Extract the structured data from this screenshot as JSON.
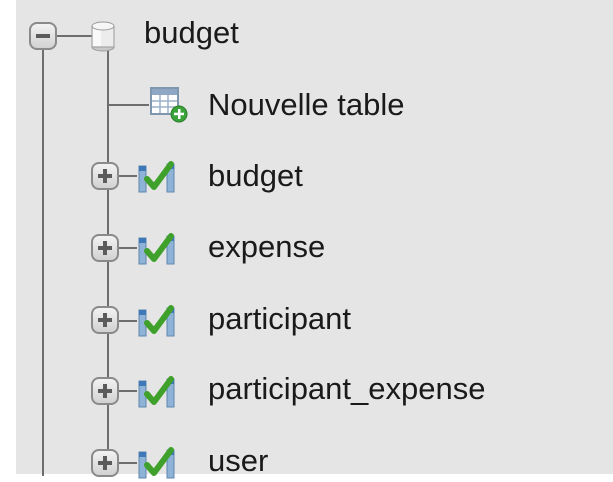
{
  "tree": {
    "database": {
      "label": "budget",
      "expanded": true
    },
    "new_table": {
      "label": "Nouvelle table"
    },
    "tables": [
      {
        "label": "budget"
      },
      {
        "label": "expense"
      },
      {
        "label": "participant"
      },
      {
        "label": "participant_expense"
      },
      {
        "label": "user"
      }
    ]
  },
  "colors": {
    "panel_background": "#e5e5e5",
    "tree_line": "#6e6e6e",
    "text": "#1a1a1a",
    "table_icon_check": "#3fa12b",
    "new_table_badge": "#3aa33a"
  }
}
